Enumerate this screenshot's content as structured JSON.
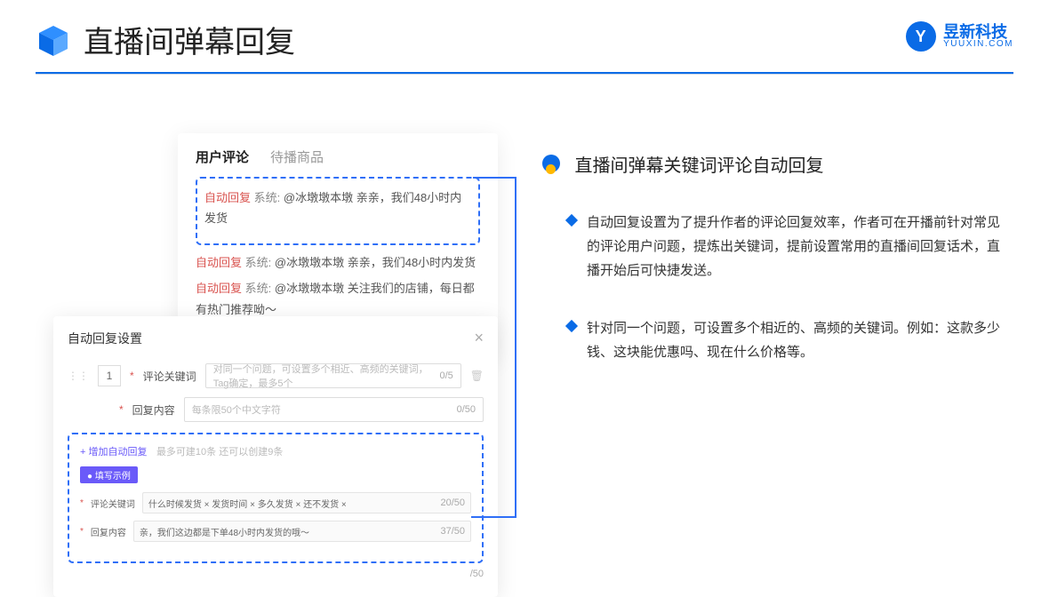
{
  "header": {
    "title": "直播间弹幕回复"
  },
  "brand": {
    "cn": "昱新科技",
    "en": "YUUXIN.COM"
  },
  "comments": {
    "tabs": {
      "active": "用户评论",
      "inactive": "待播商品"
    },
    "highlighted": {
      "tag": "自动回复",
      "prefix": "系统:",
      "mention": "@冰墩墩本墩",
      "text": "亲亲，我们48小时内发货"
    },
    "line2": {
      "tag": "自动回复",
      "prefix": "系统:",
      "mention": "@冰墩墩本墩",
      "text": "亲亲，我们48小时内发货"
    },
    "line3": {
      "tag": "自动回复",
      "prefix": "系统:",
      "mention": "@冰墩墩本墩",
      "text": "关注我们的店铺，每日都有热门推荐呦～"
    }
  },
  "settings": {
    "title": "自动回复设置",
    "close": "×",
    "index": "1",
    "keyword_label": "评论关键词",
    "keyword_placeholder": "对同一个问题，可设置多个相近、高频的关键词，Tag确定，最多5个",
    "keyword_counter": "0/5",
    "content_label": "回复内容",
    "content_placeholder": "每条限50个中文字符",
    "content_counter": "0/50",
    "add_link": "+ 增加自动回复",
    "add_hint": "最多可建10条 还可以创建9条",
    "example_badge": "● 填写示例",
    "ex_keyword_label": "评论关键词",
    "ex_tags": "什么时候发货 ×   发货时间 ×   多久发货 ×   还不发货 ×",
    "ex_keyword_counter": "20/50",
    "ex_content_label": "回复内容",
    "ex_content": "亲，我们这边都是下单48小时内发货的哦～",
    "ex_content_counter": "37/50",
    "outer_counter": "/50"
  },
  "right": {
    "section_title": "直播间弹幕关键词评论自动回复",
    "point1": "自动回复设置为了提升作者的评论回复效率，作者可在开播前针对常见的评论用户问题，提炼出关键词，提前设置常用的直播间回复话术，直播开始后可快捷发送。",
    "point2": "针对同一个问题，可设置多个相近的、高频的关键词。例如：这款多少钱、这块能优惠吗、现在什么价格等。"
  }
}
